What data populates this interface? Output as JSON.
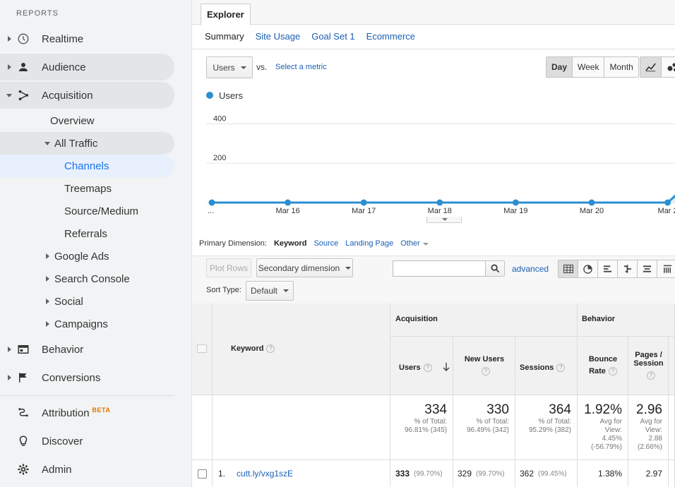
{
  "sidebar": {
    "heading": "REPORTS",
    "items": {
      "realtime": "Realtime",
      "audience": "Audience",
      "acquisition": "Acquisition",
      "overview": "Overview",
      "all_traffic": "All Traffic",
      "channels": "Channels",
      "treemaps": "Treemaps",
      "source_medium": "Source/Medium",
      "referrals": "Referrals",
      "google_ads": "Google Ads",
      "search_console": "Search Console",
      "social": "Social",
      "campaigns": "Campaigns",
      "behavior": "Behavior",
      "conversions": "Conversions",
      "attribution": "Attribution",
      "attribution_badge": "BETA",
      "discover": "Discover",
      "admin": "Admin"
    }
  },
  "main": {
    "tab": "Explorer",
    "subtabs": [
      "Summary",
      "Site Usage",
      "Goal Set 1",
      "Ecommerce"
    ],
    "metric_select": "Users",
    "vs": "vs.",
    "select_metric": "Select a metric",
    "period": [
      "Day",
      "Week",
      "Month"
    ],
    "legend": "Users",
    "primary_dimension": {
      "label": "Primary Dimension:",
      "current": "Keyword",
      "options": [
        "Source",
        "Landing Page"
      ],
      "other": "Other"
    },
    "plot_rows": "Plot Rows",
    "secondary_dimension": "Secondary dimension",
    "advanced": "advanced",
    "sort_type_label": "Sort Type:",
    "sort_type_value": "Default"
  },
  "chart_data": {
    "type": "area",
    "series": [
      {
        "name": "Users",
        "values": [
          0,
          0,
          0,
          0,
          0,
          0,
          0,
          345
        ]
      }
    ],
    "x_labels": [
      "...",
      "Mar 16",
      "Mar 17",
      "Mar 18",
      "Mar 19",
      "Mar 20",
      "Mar 2"
    ],
    "y_ticks": [
      200,
      400
    ],
    "ylim": [
      0,
      480
    ],
    "color": "#2b8fd1"
  },
  "table": {
    "groups": {
      "acquisition": "Acquisition",
      "behavior": "Behavior"
    },
    "headers": {
      "keyword": "Keyword",
      "users": "Users",
      "new_users": "New Users",
      "sessions": "Sessions",
      "bounce_rate_1": "Bounce",
      "bounce_rate_2": "Rate",
      "pages_session_1": "Pages /",
      "pages_session_2": "Session"
    },
    "totals": {
      "users": {
        "big": "334",
        "l1": "% of Total:",
        "l2": "96.81% (345)"
      },
      "new_users": {
        "big": "330",
        "l1": "% of Total:",
        "l2": "96.49% (342)"
      },
      "sessions": {
        "big": "364",
        "l1": "% of Total:",
        "l2": "95.29% (382)"
      },
      "bounce": {
        "big": "1.92%",
        "l1": "Avg for",
        "l2": "View:",
        "l3": "4.45%",
        "l4": "(-56.79%)"
      },
      "pages": {
        "big": "2.96",
        "l1": "Avg for",
        "l2": "View:",
        "l3": "2.88",
        "l4": "(2.66%)"
      }
    },
    "rows": [
      {
        "index": "1.",
        "keyword": "cutt.ly/vxg1szE",
        "users": "333",
        "users_pct": "(99.70%)",
        "new_users": "329",
        "new_users_pct": "(99.70%)",
        "sessions": "362",
        "sessions_pct": "(99.45%)",
        "bounce": "1.38%",
        "pages": "2.97"
      }
    ]
  }
}
